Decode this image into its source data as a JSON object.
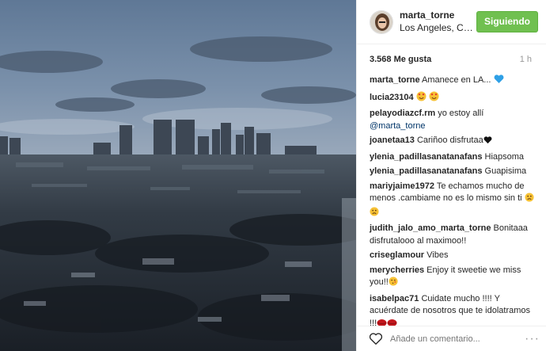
{
  "header": {
    "username": "marta_torne",
    "location": "Los Angeles, Cal...",
    "follow_label": "Siguiendo"
  },
  "stats": {
    "likes": "3.568 Me gusta",
    "time": "1 h"
  },
  "comments": [
    {
      "user": "marta_torne",
      "text": "Amanece en LA...",
      "emoji": [
        "blue-heart"
      ]
    },
    {
      "user": "lucia23104",
      "text": "",
      "emoji": [
        "heart-eyes",
        "heart-eyes"
      ]
    },
    {
      "user": "pelayodiazcf.rm",
      "text": "yo estoy allí",
      "mention": "@marta_torne"
    },
    {
      "user": "joanetaa13",
      "text": "Cariñoo disfrutaa",
      "emoji": [
        "black-heart"
      ]
    },
    {
      "user": "ylenia_padillasanatanafans",
      "text": "Hiapsoma"
    },
    {
      "user": "ylenia_padillasanatanafans",
      "text": "Guapisima"
    },
    {
      "user": "mariyjaime1972",
      "text": "Te echamos mucho de menos .cambiame no es lo mismo sin ti",
      "emoji": [
        "sad-face",
        "sad-face"
      ]
    },
    {
      "user": "judith_jalo_amo_marta_torne",
      "text": "Bonitaaa disfrutalooo al maximoo!!"
    },
    {
      "user": "criseglamour",
      "text": "Vibes"
    },
    {
      "user": "merycherries",
      "text": "Enjoy it sweetie we miss you!!",
      "emoji": [
        "kiss-face"
      ]
    },
    {
      "user": "isabelpac71",
      "text": "Cuidate mucho !!!! Y acuérdate de nosotros que te idolatramos !!!",
      "emoji": [
        "lips",
        "lips"
      ]
    }
  ],
  "footer": {
    "placeholder": "Añade un comentario...",
    "more": "···"
  }
}
